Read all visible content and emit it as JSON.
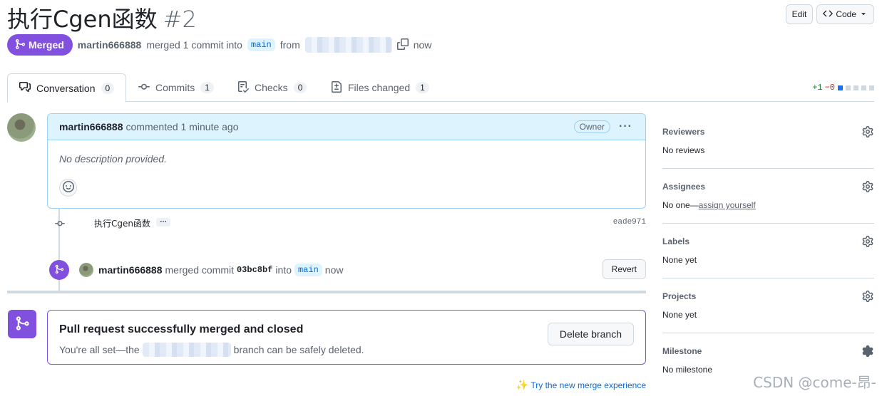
{
  "header": {
    "title": "执行Cgen函数",
    "number": "#2",
    "edit_label": "Edit",
    "code_label": "Code"
  },
  "meta": {
    "state": "Merged",
    "user": "martin666888",
    "action": "merged 1 commit into",
    "base_branch": "main",
    "from": "from",
    "time": "now"
  },
  "tabs": [
    {
      "label": "Conversation",
      "count": "0"
    },
    {
      "label": "Commits",
      "count": "1"
    },
    {
      "label": "Checks",
      "count": "0"
    },
    {
      "label": "Files changed",
      "count": "1"
    }
  ],
  "diffstat": {
    "additions": "+1",
    "deletions": "−0"
  },
  "comment": {
    "user": "martin666888",
    "action": "commented 1 minute ago",
    "badge": "Owner",
    "body": "No description provided."
  },
  "commit": {
    "message": "执行Cgen函数",
    "more": "…",
    "sha": "eade971"
  },
  "merge_event": {
    "user": "martin666888",
    "action": "merged commit",
    "sha": "03bc8bf",
    "into": "into",
    "branch": "main",
    "time": "now",
    "revert_label": "Revert"
  },
  "merged_box": {
    "heading": "Pull request successfully merged and closed",
    "sub_prefix": "You're all set—the",
    "sub_suffix": "branch can be safely deleted.",
    "delete_label": "Delete branch"
  },
  "try_link": "Try the new merge experience",
  "sidebar": {
    "reviewers": {
      "title": "Reviewers",
      "value": "No reviews"
    },
    "assignees": {
      "title": "Assignees",
      "value_prefix": "No one—",
      "link": "assign yourself"
    },
    "labels": {
      "title": "Labels",
      "value": "None yet"
    },
    "projects": {
      "title": "Projects",
      "value": "None yet"
    },
    "milestone": {
      "title": "Milestone",
      "value": "No milestone"
    }
  },
  "watermark": "CSDN @come-昂-",
  "colors": {
    "merged": "#8250df",
    "link": "#0969da",
    "branch_bg": "#ddf4ff"
  }
}
